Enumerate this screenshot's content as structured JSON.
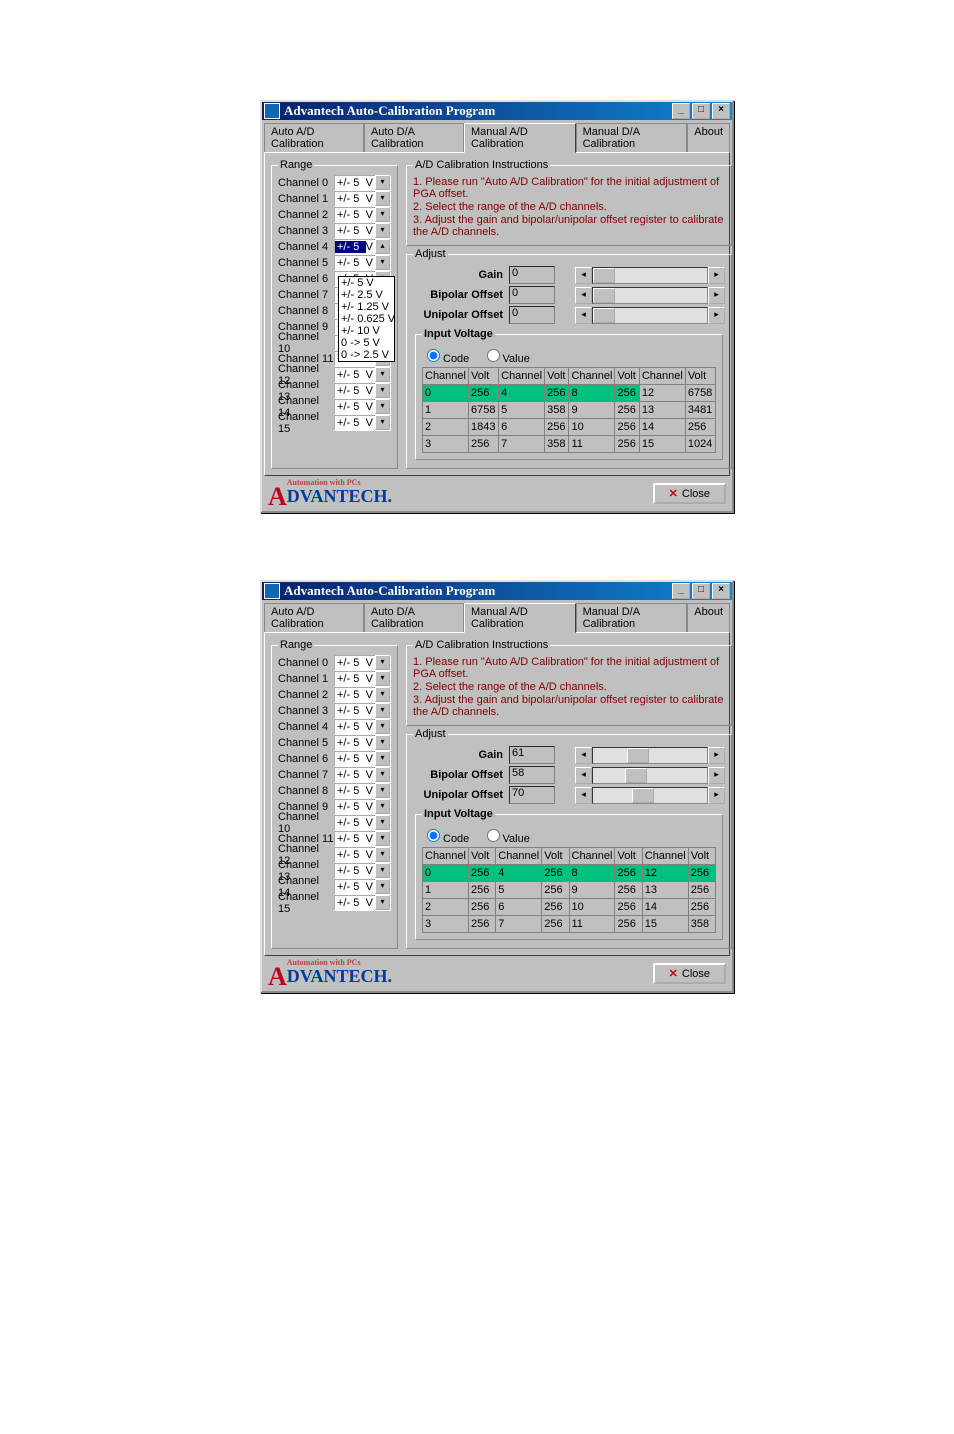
{
  "window_title": "Advantech Auto-Calibration Program",
  "tabs": [
    "Auto A/D Calibration",
    "Auto D/A Calibration",
    "Manual A/D Calibration",
    "Manual D/A Calibration",
    "About"
  ],
  "active_tab": 2,
  "groups": {
    "range_title": "Range",
    "instructions_title": "A/D Calibration Instructions",
    "adjust_title": "Adjust",
    "input_voltage_title": "Input Voltage"
  },
  "instructions": [
    "1. Please run \"Auto A/D Calibration\" for the initial adjustment of PGA offset.",
    "2. Select the range of the A/D channels.",
    "3. Adjust the gain and bipolar/unipolar offset register to calibrate the A/D channels."
  ],
  "range_unit": "V",
  "dropdown_open_options": [
    "+/- 5",
    "+/- 2.5",
    "+/- 1.25",
    "+/- 0.625",
    "+/- 10",
    "0 -> 5",
    "0 -> 2.5"
  ],
  "channels1": [
    {
      "label": "Channel 0",
      "value": "+/- 5"
    },
    {
      "label": "Channel 1",
      "value": "+/- 5"
    },
    {
      "label": "Channel 2",
      "value": "+/- 5"
    },
    {
      "label": "Channel 3",
      "value": "+/- 5"
    },
    {
      "label": "Channel 4",
      "value": "+/- 5",
      "selected": true,
      "open": true
    },
    {
      "label": "Channel 5",
      "value": "+/- 5"
    },
    {
      "label": "Channel 6",
      "value": "+/- 5"
    },
    {
      "label": "Channel 7",
      "value": "+/- 5"
    },
    {
      "label": "Channel 8",
      "value": "+/- 5"
    },
    {
      "label": "Channel 9",
      "value": "+/- 5"
    },
    {
      "label": "Channel 10",
      "value": "+/- 5"
    },
    {
      "label": "Channel 11",
      "value": "+/- 5"
    },
    {
      "label": "Channel 12",
      "value": "+/- 5"
    },
    {
      "label": "Channel 13",
      "value": "+/- 5"
    },
    {
      "label": "Channel 14",
      "value": "+/- 5"
    },
    {
      "label": "Channel 15",
      "value": "+/- 5"
    }
  ],
  "channels2": [
    {
      "label": "Channel 0",
      "value": "+/- 5"
    },
    {
      "label": "Channel 1",
      "value": "+/- 5"
    },
    {
      "label": "Channel 2",
      "value": "+/- 5"
    },
    {
      "label": "Channel 3",
      "value": "+/- 5"
    },
    {
      "label": "Channel 4",
      "value": "+/- 5"
    },
    {
      "label": "Channel 5",
      "value": "+/- 5"
    },
    {
      "label": "Channel 6",
      "value": "+/- 5"
    },
    {
      "label": "Channel 7",
      "value": "+/- 5"
    },
    {
      "label": "Channel 8",
      "value": "+/- 5"
    },
    {
      "label": "Channel 9",
      "value": "+/- 5"
    },
    {
      "label": "Channel 10",
      "value": "+/- 5"
    },
    {
      "label": "Channel 11",
      "value": "+/- 5"
    },
    {
      "label": "Channel 12",
      "value": "+/- 5"
    },
    {
      "label": "Channel 13",
      "value": "+/- 5"
    },
    {
      "label": "Channel 14",
      "value": "+/- 5"
    },
    {
      "label": "Channel 15",
      "value": "+/- 5"
    }
  ],
  "adjust_labels": {
    "gain": "Gain",
    "bipolar": "Bipolar Offset",
    "unipolar": "Unipolar Offset"
  },
  "adjust1": {
    "gain": "0",
    "bipolar": "0",
    "unipolar": "0",
    "thumb_pos": [
      0,
      0,
      0
    ]
  },
  "adjust2": {
    "gain": "61",
    "bipolar": "58",
    "unipolar": "70",
    "thumb_pos": [
      30,
      28,
      34
    ]
  },
  "iv_radio": {
    "code": "Code",
    "value": "Value"
  },
  "table_headers": [
    "Channel",
    "Volt",
    "Channel",
    "Volt",
    "Channel",
    "Volt",
    "Channel",
    "Volt"
  ],
  "table1": [
    [
      {
        "t": "0",
        "hi": 1
      },
      {
        "t": "256",
        "hi": 1
      },
      {
        "t": "4",
        "hi": 1
      },
      {
        "t": "256",
        "hi": 1
      },
      {
        "t": "8",
        "hi": 1
      },
      {
        "t": "256",
        "hi": 1
      },
      {
        "t": "12"
      },
      {
        "t": "6758"
      }
    ],
    [
      {
        "t": "1"
      },
      {
        "t": "6758"
      },
      {
        "t": "5"
      },
      {
        "t": "358"
      },
      {
        "t": "9"
      },
      {
        "t": "256"
      },
      {
        "t": "13"
      },
      {
        "t": "3481"
      }
    ],
    [
      {
        "t": "2"
      },
      {
        "t": "1843"
      },
      {
        "t": "6"
      },
      {
        "t": "256"
      },
      {
        "t": "10"
      },
      {
        "t": "256"
      },
      {
        "t": "14"
      },
      {
        "t": "256"
      }
    ],
    [
      {
        "t": "3"
      },
      {
        "t": "256"
      },
      {
        "t": "7"
      },
      {
        "t": "358"
      },
      {
        "t": "11"
      },
      {
        "t": "256"
      },
      {
        "t": "15"
      },
      {
        "t": "1024"
      }
    ]
  ],
  "table2": [
    [
      {
        "t": "0",
        "hi": 1
      },
      {
        "t": "256",
        "hi": 1
      },
      {
        "t": "4",
        "hi": 1
      },
      {
        "t": "256",
        "hi": 1
      },
      {
        "t": "8",
        "hi": 1
      },
      {
        "t": "256",
        "hi": 1
      },
      {
        "t": "12",
        "hi": 1
      },
      {
        "t": "256",
        "hi": 1
      }
    ],
    [
      {
        "t": "1"
      },
      {
        "t": "256"
      },
      {
        "t": "5"
      },
      {
        "t": "256"
      },
      {
        "t": "9"
      },
      {
        "t": "256"
      },
      {
        "t": "13"
      },
      {
        "t": "256"
      }
    ],
    [
      {
        "t": "2"
      },
      {
        "t": "256"
      },
      {
        "t": "6"
      },
      {
        "t": "256"
      },
      {
        "t": "10"
      },
      {
        "t": "256"
      },
      {
        "t": "14"
      },
      {
        "t": "256"
      }
    ],
    [
      {
        "t": "3"
      },
      {
        "t": "256"
      },
      {
        "t": "7"
      },
      {
        "t": "256"
      },
      {
        "t": "11"
      },
      {
        "t": "256"
      },
      {
        "t": "15"
      },
      {
        "t": "358"
      }
    ]
  ],
  "logo_tag": "Automation with PCs",
  "logo_text": "DVANTECH.",
  "close_label": "Close"
}
